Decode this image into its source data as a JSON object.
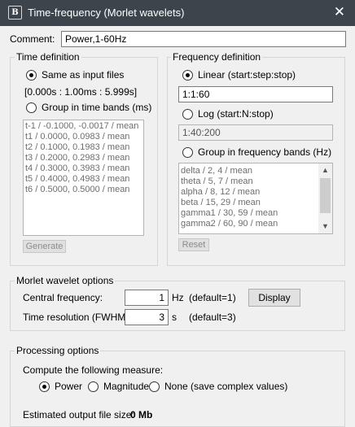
{
  "window": {
    "icon_text": "B",
    "title": "Time-frequency (Morlet wavelets)",
    "close_glyph": "✕"
  },
  "comment": {
    "label": "Comment:",
    "value": "Power,1-60Hz"
  },
  "time_definition": {
    "title": "Time definition",
    "same_as_input_label": "Same as input files",
    "same_as_input_selected": true,
    "range_text": "[0.000s : 1.00ms : 5.999s]",
    "group_bands_label": "Group in time bands (ms)",
    "group_bands_selected": false,
    "bands": [
      "t-1 / -0.1000, -0.0017 / mean",
      "t1 / 0.0000, 0.0983 / mean",
      "t2 / 0.1000, 0.1983 / mean",
      "t3 / 0.2000, 0.2983 / mean",
      "t4 / 0.3000, 0.3983 / mean",
      "t5 / 0.4000, 0.4983 / mean",
      "t6 / 0.5000, 0.5000 / mean"
    ],
    "generate_label": "Generate"
  },
  "frequency_definition": {
    "title": "Frequency definition",
    "linear_label": "Linear (start:step:stop)",
    "linear_selected": true,
    "linear_value": "1:1:60",
    "log_label": "Log (start:N:stop)",
    "log_selected": false,
    "log_value": "1:40:200",
    "group_bands_label": "Group in frequency bands (Hz)",
    "group_bands_selected": false,
    "bands": [
      "delta / 2, 4 / mean",
      "theta / 5, 7 / mean",
      "alpha / 8, 12 / mean",
      "beta / 15, 29 / mean",
      "gamma1 / 30, 59 / mean",
      "gamma2 / 60, 90 / mean"
    ],
    "reset_label": "Reset",
    "scroll_up_glyph": "▲",
    "scroll_down_glyph": "▼"
  },
  "morlet": {
    "title": "Morlet wavelet options",
    "central_freq_label": "Central frequency:",
    "central_freq_value": "1",
    "central_freq_unit": "Hz",
    "central_freq_default": "(default=1)",
    "display_label": "Display",
    "time_res_label": "Time resolution (FWHM):",
    "time_res_value": "3",
    "time_res_unit": "s",
    "time_res_default": "(default=3)"
  },
  "processing": {
    "title": "Processing options",
    "measure_prompt": "Compute the following measure:",
    "options": [
      {
        "label": "Power",
        "selected": true
      },
      {
        "label": "Magnitude",
        "selected": false
      },
      {
        "label": "None (save complex values)",
        "selected": false
      }
    ],
    "output_size_label": "Estimated output file size:",
    "output_size_value": "0 Mb"
  }
}
